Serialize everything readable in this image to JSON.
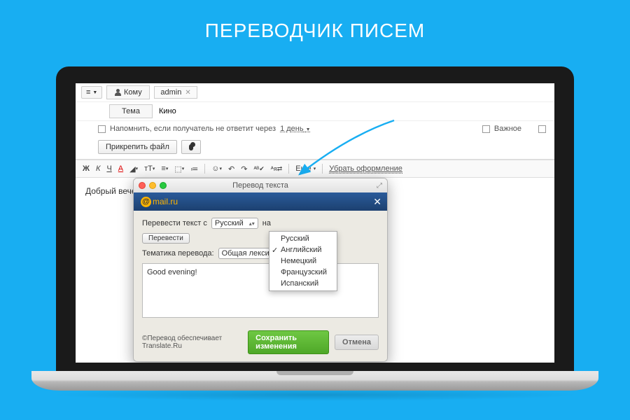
{
  "page_title": "ПЕРЕВОДЧИК ПИСЕМ",
  "compose": {
    "to_label": "Кому",
    "to_chip": "admin",
    "subject_label": "Тема",
    "subject_value": "Кино",
    "reminder_text": "Напомнить, если получатель не ответит через",
    "reminder_period": "1 день",
    "important_label": "Важное",
    "attach_label": "Прикрепить файл"
  },
  "toolbar": {
    "bold": "Ж",
    "italic": "К",
    "underline": "Ч",
    "color": "А",
    "font_size": "тТ",
    "more_label": "Еще",
    "clear_format": "Убрать оформление"
  },
  "body_text": "Добрый вечер!",
  "popup": {
    "window_title": "Перевод текста",
    "logo_text": "mail.ru",
    "translate_prefix": "Перевести текст с",
    "from_lang": "Русский",
    "to_word": "на",
    "translate_btn": "Перевести",
    "topic_label": "Тематика перевода:",
    "topic_value": "Общая лексика",
    "result_text": "Good evening!",
    "footer_note": "©Перевод обеспечивает Translate.Ru",
    "save_btn": "Сохранить изменения",
    "cancel_btn": "Отмена",
    "lang_options": [
      "Русский",
      "Английский",
      "Немецкий",
      "Французский",
      "Испанский"
    ],
    "lang_selected_index": 1
  }
}
